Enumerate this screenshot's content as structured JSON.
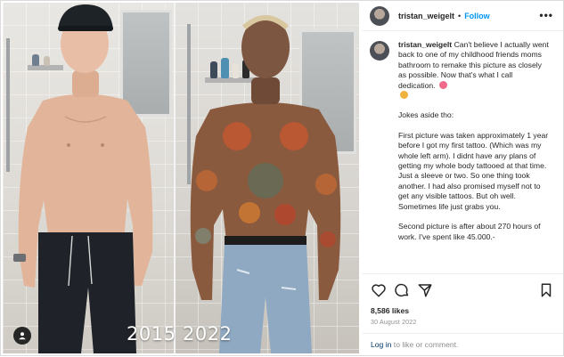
{
  "post": {
    "username": "tristan_weigelt",
    "separator": "•",
    "follow_label": "Follow",
    "more_icon": "ellipsis-icon",
    "caption_paragraphs": [
      "Can't believe I actually went back to one of my childhood friends moms bathroom to remake this picture as closely as possible. Now that's what I call dedication.",
      "Jokes aside tho:",
      "First picture was taken approximately 1 year before I got my first tattoo. (Which was my whole left arm). I didnt have any plans of getting my whole body tattooed at that time. Just a sleeve or two. So one thing took another. I had also promised myself not to get any visible tattoos. But oh well. Sometimes life just grabs you.",
      "Second picture is after about 270 hours of work. I've spent like 45.000.-"
    ],
    "likes": "8,586 likes",
    "date": "30 August 2022",
    "login_link": "Log in",
    "login_rest": " to like or comment."
  },
  "photo": {
    "left_year": "2015",
    "right_year": "2022",
    "tag_icon": "user-tag-icon"
  },
  "actions": {
    "like_icon": "heart-icon",
    "comment_icon": "comment-icon",
    "share_icon": "share-icon",
    "save_icon": "bookmark-icon"
  },
  "colors": {
    "follow": "#0095f6",
    "link": "#00376b",
    "muted": "#8e8e8e"
  }
}
